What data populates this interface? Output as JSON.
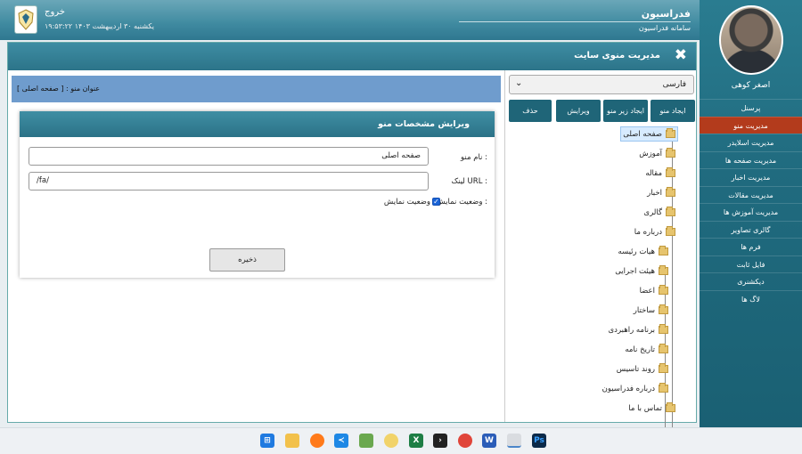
{
  "header": {
    "site_title": "فدراسیون",
    "site_subtitle": "سامانه فدراسیون",
    "logout": "خروج",
    "datetime": "یکشنبه ۳۰ اردیبهشت ۱۴۰۳   ۱۹:۵۳:۲۲"
  },
  "sidebar": {
    "username": "اصغر کوهی",
    "items": [
      {
        "label": "پرسنل"
      },
      {
        "label": "مدیریت منو",
        "active": true
      },
      {
        "label": "مدیریت اسلایدر"
      },
      {
        "label": "مدیریت صفحه ها"
      },
      {
        "label": "مدیریت اخبار"
      },
      {
        "label": "مدیریت مقالات"
      },
      {
        "label": "مدیریت آموزش ها"
      },
      {
        "label": "گالری تصاویر"
      },
      {
        "label": "فرم ها"
      },
      {
        "label": "فایل ثابت"
      },
      {
        "label": "دیکشنری"
      },
      {
        "label": "لاگ ها"
      }
    ]
  },
  "panel": {
    "title": "مدیریت منوی سایت",
    "close_icon": "close-icon"
  },
  "tree": {
    "language": "فارسی",
    "buttons": {
      "create": "ایجاد منو",
      "create_sub": "ایجاد زیر منو",
      "edit": "ویرایش",
      "delete": "حذف"
    },
    "nodes": [
      {
        "label": "صفحه اصلی"
      },
      {
        "label": "آموزش"
      },
      {
        "label": "مقاله"
      },
      {
        "label": "اخبار"
      },
      {
        "label": "گالری"
      },
      {
        "label": "درباره ما"
      },
      {
        "label": "هیات رئیسه"
      },
      {
        "label": "هیئت اجرایی"
      },
      {
        "label": "اعضا"
      },
      {
        "label": "ساختار"
      },
      {
        "label": "برنامه راهبردی"
      },
      {
        "label": "تاریخ نامه"
      },
      {
        "label": "روند تاسیس"
      },
      {
        "label": "درباره فدراسیون"
      },
      {
        "label": "تماس با ما"
      }
    ]
  },
  "menu_title": "عنوان منو : [ صفحه اصلی ]",
  "edit": {
    "title": "ویرایش مشخصات منو",
    "name_label": "نام منو :",
    "name_value": "صفحه اصلی",
    "url_label": "لینک URL :",
    "url_value": "/fa/",
    "display_label": "وضعیت نمایش :",
    "display_checkbox_label": "وضعیت نمایش",
    "display_checked": true,
    "save": "ذخیره"
  },
  "taskbar": {
    "icons": [
      "windows-start-icon",
      "file-explorer-icon",
      "firefox-icon",
      "vscode-icon",
      "paint-icon",
      "app-icon",
      "excel-icon",
      "terminal-icon",
      "chrome-icon",
      "word-icon",
      "powerpoint-icon",
      "photoshop-icon"
    ]
  }
}
